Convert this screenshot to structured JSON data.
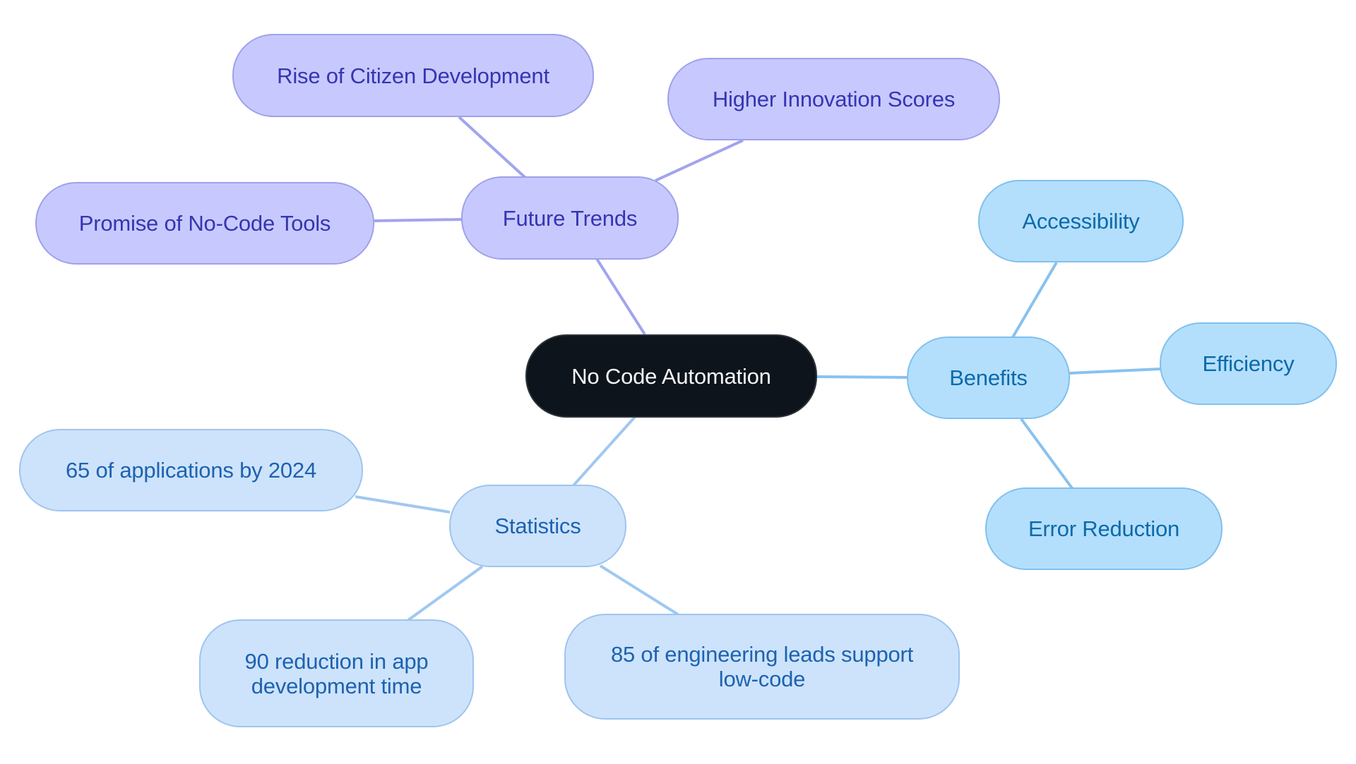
{
  "diagram": {
    "type": "mind-map",
    "root": {
      "id": "root",
      "label": "No Code Automation"
    },
    "branches": [
      {
        "id": "trends",
        "label": "Future Trends",
        "color": {
          "fill": "#c7c9fe",
          "border": "#9ea1ea",
          "text": "#3535b3",
          "edge": "#a2a4ee"
        },
        "children": [
          {
            "id": "rise",
            "label": "Rise of Citizen Development"
          },
          {
            "id": "higher",
            "label": "Higher Innovation Scores"
          },
          {
            "id": "promise",
            "label": "Promise of No-Code Tools"
          }
        ]
      },
      {
        "id": "benefits",
        "label": "Benefits",
        "color": {
          "fill": "#b3dffd",
          "border": "#81c0ec",
          "text": "#0c6aa8",
          "edge": "#88c2ef"
        },
        "children": [
          {
            "id": "access",
            "label": "Accessibility"
          },
          {
            "id": "eff",
            "label": "Efficiency"
          },
          {
            "id": "err",
            "label": "Error Reduction"
          }
        ]
      },
      {
        "id": "stats",
        "label": "Statistics",
        "color": {
          "fill": "#cde3fb",
          "border": "#9fc4ee",
          "text": "#1d62b0",
          "edge": "#a0c8f0"
        },
        "children": [
          {
            "id": "s65",
            "label": "65 of applications by 2024"
          },
          {
            "id": "s90",
            "label": "90 reduction in app development time"
          },
          {
            "id": "s85",
            "label": "85 of engineering leads support low-code"
          }
        ]
      }
    ],
    "root_color": {
      "fill": "#0d141b",
      "text": "#f4f6f8"
    }
  }
}
